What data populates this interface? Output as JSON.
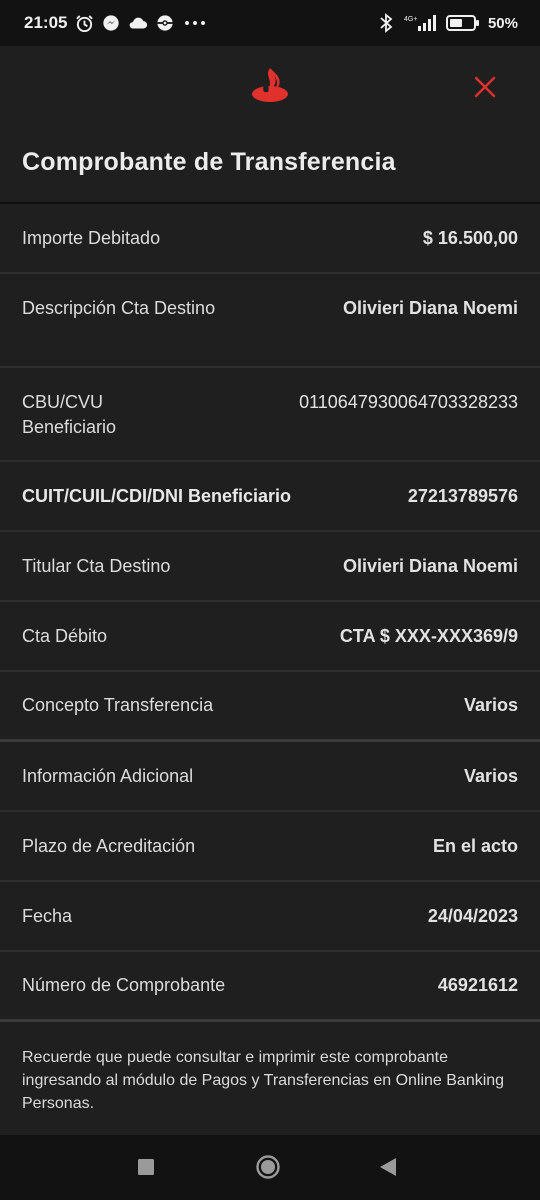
{
  "status_bar": {
    "time": "21:05",
    "network": "4G+",
    "battery": "50%",
    "icons": [
      "alarm-icon",
      "messenger-icon",
      "cloud-icon",
      "pokeball-icon",
      "more-dots-icon",
      "bluetooth-icon",
      "signal-icon",
      "battery-icon"
    ]
  },
  "header": {
    "logo": "santander-flame-logo",
    "close_icon": "close-icon",
    "brand_color": "#e0312d"
  },
  "title": "Comprobante de Transferencia",
  "rows": [
    {
      "label": "Importe Debitado",
      "value": "$ 16.500,00"
    },
    {
      "label": "Descripción Cta Destino",
      "value": "Olivieri Diana Noemi"
    },
    {
      "label": "CBU/CVU Beneficiario",
      "value": "0110647930064703328233"
    },
    {
      "label": "CUIT/CUIL/CDI/DNI Beneficiario",
      "value": "27213789576"
    },
    {
      "label": "Titular Cta Destino",
      "value": "Olivieri Diana Noemi"
    },
    {
      "label": "Cta Débito",
      "value": "CTA $ XXX-XXX369/9"
    },
    {
      "label": "Concepto Transferencia",
      "value": "Varios"
    },
    {
      "label": "Información Adicional",
      "value": "Varios"
    },
    {
      "label": "Plazo de Acreditación",
      "value": "En el acto"
    },
    {
      "label": "Fecha",
      "value": "24/04/2023"
    },
    {
      "label": "Número de Comprobante",
      "value": "46921612"
    }
  ],
  "footer_note": "Recuerde que puede consultar e imprimir este comprobante ingresando al módulo de Pagos y Transferencias en Online Banking Personas.",
  "nav_bar": {
    "buttons": [
      "recent-apps-icon",
      "home-icon",
      "back-icon"
    ]
  }
}
